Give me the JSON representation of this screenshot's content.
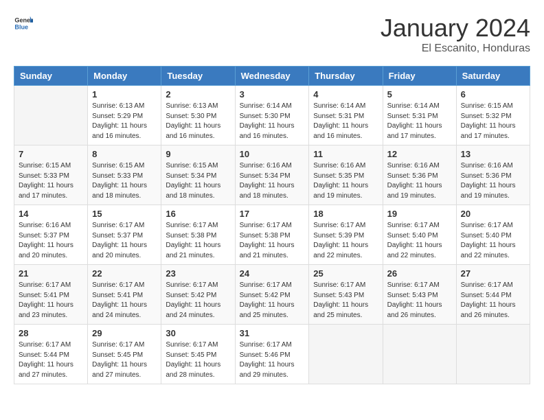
{
  "header": {
    "logo_general": "General",
    "logo_blue": "Blue",
    "month": "January 2024",
    "location": "El Escanito, Honduras"
  },
  "days_of_week": [
    "Sunday",
    "Monday",
    "Tuesday",
    "Wednesday",
    "Thursday",
    "Friday",
    "Saturday"
  ],
  "weeks": [
    [
      {
        "day": "",
        "info": ""
      },
      {
        "day": "1",
        "info": "Sunrise: 6:13 AM\nSunset: 5:29 PM\nDaylight: 11 hours and 16 minutes."
      },
      {
        "day": "2",
        "info": "Sunrise: 6:13 AM\nSunset: 5:30 PM\nDaylight: 11 hours and 16 minutes."
      },
      {
        "day": "3",
        "info": "Sunrise: 6:14 AM\nSunset: 5:30 PM\nDaylight: 11 hours and 16 minutes."
      },
      {
        "day": "4",
        "info": "Sunrise: 6:14 AM\nSunset: 5:31 PM\nDaylight: 11 hours and 16 minutes."
      },
      {
        "day": "5",
        "info": "Sunrise: 6:14 AM\nSunset: 5:31 PM\nDaylight: 11 hours and 17 minutes."
      },
      {
        "day": "6",
        "info": "Sunrise: 6:15 AM\nSunset: 5:32 PM\nDaylight: 11 hours and 17 minutes."
      }
    ],
    [
      {
        "day": "7",
        "info": "Sunrise: 6:15 AM\nSunset: 5:33 PM\nDaylight: 11 hours and 17 minutes."
      },
      {
        "day": "8",
        "info": "Sunrise: 6:15 AM\nSunset: 5:33 PM\nDaylight: 11 hours and 18 minutes."
      },
      {
        "day": "9",
        "info": "Sunrise: 6:15 AM\nSunset: 5:34 PM\nDaylight: 11 hours and 18 minutes."
      },
      {
        "day": "10",
        "info": "Sunrise: 6:16 AM\nSunset: 5:34 PM\nDaylight: 11 hours and 18 minutes."
      },
      {
        "day": "11",
        "info": "Sunrise: 6:16 AM\nSunset: 5:35 PM\nDaylight: 11 hours and 19 minutes."
      },
      {
        "day": "12",
        "info": "Sunrise: 6:16 AM\nSunset: 5:36 PM\nDaylight: 11 hours and 19 minutes."
      },
      {
        "day": "13",
        "info": "Sunrise: 6:16 AM\nSunset: 5:36 PM\nDaylight: 11 hours and 19 minutes."
      }
    ],
    [
      {
        "day": "14",
        "info": "Sunrise: 6:16 AM\nSunset: 5:37 PM\nDaylight: 11 hours and 20 minutes."
      },
      {
        "day": "15",
        "info": "Sunrise: 6:17 AM\nSunset: 5:37 PM\nDaylight: 11 hours and 20 minutes."
      },
      {
        "day": "16",
        "info": "Sunrise: 6:17 AM\nSunset: 5:38 PM\nDaylight: 11 hours and 21 minutes."
      },
      {
        "day": "17",
        "info": "Sunrise: 6:17 AM\nSunset: 5:38 PM\nDaylight: 11 hours and 21 minutes."
      },
      {
        "day": "18",
        "info": "Sunrise: 6:17 AM\nSunset: 5:39 PM\nDaylight: 11 hours and 22 minutes."
      },
      {
        "day": "19",
        "info": "Sunrise: 6:17 AM\nSunset: 5:40 PM\nDaylight: 11 hours and 22 minutes."
      },
      {
        "day": "20",
        "info": "Sunrise: 6:17 AM\nSunset: 5:40 PM\nDaylight: 11 hours and 22 minutes."
      }
    ],
    [
      {
        "day": "21",
        "info": "Sunrise: 6:17 AM\nSunset: 5:41 PM\nDaylight: 11 hours and 23 minutes."
      },
      {
        "day": "22",
        "info": "Sunrise: 6:17 AM\nSunset: 5:41 PM\nDaylight: 11 hours and 24 minutes."
      },
      {
        "day": "23",
        "info": "Sunrise: 6:17 AM\nSunset: 5:42 PM\nDaylight: 11 hours and 24 minutes."
      },
      {
        "day": "24",
        "info": "Sunrise: 6:17 AM\nSunset: 5:42 PM\nDaylight: 11 hours and 25 minutes."
      },
      {
        "day": "25",
        "info": "Sunrise: 6:17 AM\nSunset: 5:43 PM\nDaylight: 11 hours and 25 minutes."
      },
      {
        "day": "26",
        "info": "Sunrise: 6:17 AM\nSunset: 5:43 PM\nDaylight: 11 hours and 26 minutes."
      },
      {
        "day": "27",
        "info": "Sunrise: 6:17 AM\nSunset: 5:44 PM\nDaylight: 11 hours and 26 minutes."
      }
    ],
    [
      {
        "day": "28",
        "info": "Sunrise: 6:17 AM\nSunset: 5:44 PM\nDaylight: 11 hours and 27 minutes."
      },
      {
        "day": "29",
        "info": "Sunrise: 6:17 AM\nSunset: 5:45 PM\nDaylight: 11 hours and 27 minutes."
      },
      {
        "day": "30",
        "info": "Sunrise: 6:17 AM\nSunset: 5:45 PM\nDaylight: 11 hours and 28 minutes."
      },
      {
        "day": "31",
        "info": "Sunrise: 6:17 AM\nSunset: 5:46 PM\nDaylight: 11 hours and 29 minutes."
      },
      {
        "day": "",
        "info": ""
      },
      {
        "day": "",
        "info": ""
      },
      {
        "day": "",
        "info": ""
      }
    ]
  ]
}
